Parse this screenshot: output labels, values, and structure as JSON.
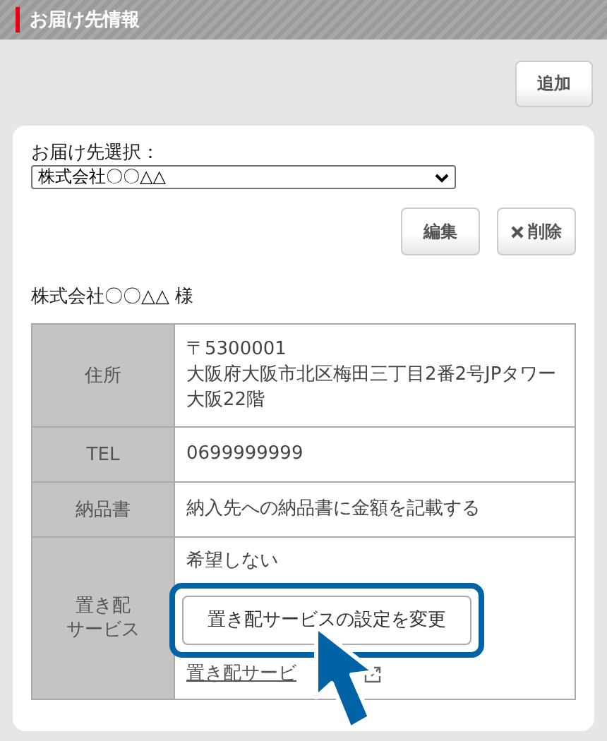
{
  "header": {
    "title": "お届け先情報"
  },
  "add_button": "追加",
  "selector": {
    "label": "お届け先選択：",
    "value": "株式会社〇〇△△"
  },
  "actions": [
    {
      "kind": "edit",
      "label": "編集"
    },
    {
      "kind": "delete",
      "label": "削除"
    }
  ],
  "recipient": "株式会社〇〇△△ 様",
  "table": {
    "rows": [
      {
        "kind": "text",
        "heading": [
          "住所"
        ],
        "lines": [
          "〒5300001",
          "大阪府大阪市北区梅田三丁目2番2号JPタワー大阪22階"
        ]
      },
      {
        "kind": "text",
        "heading": [
          "TEL"
        ],
        "lines": [
          "0699999999"
        ]
      },
      {
        "kind": "text",
        "heading": [
          "納品書"
        ],
        "lines": [
          "納入先への納品書に金額を記載する"
        ]
      },
      {
        "kind": "service",
        "heading": [
          "置き配",
          "サービス"
        ],
        "status": "希望しない",
        "button": "置き配サービスの設定を変更",
        "highlighted": true,
        "link": "置き配サービ"
      }
    ]
  }
}
